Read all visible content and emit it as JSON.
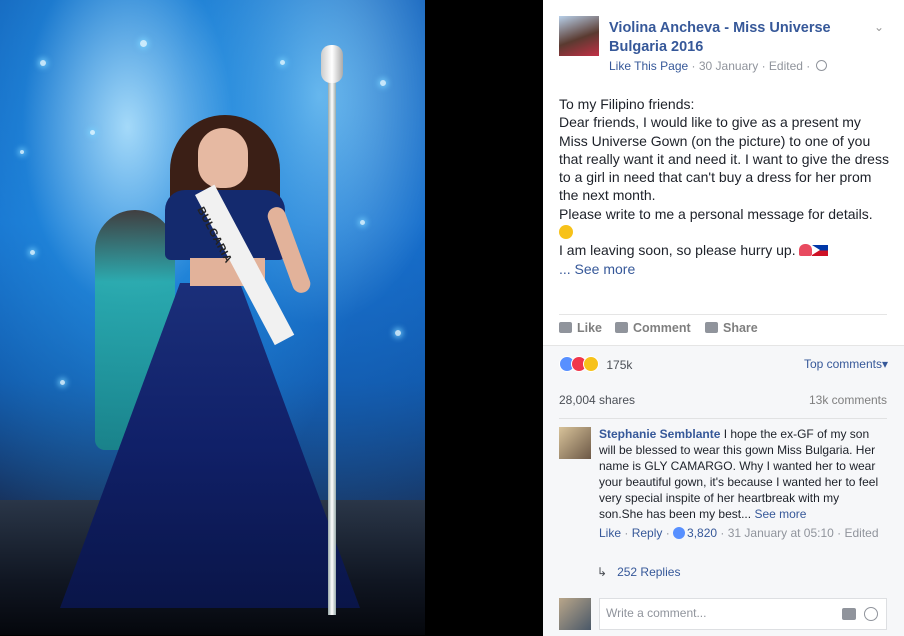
{
  "post": {
    "page_name": "Violina Ancheva - Miss Universe Bulgaria 2016",
    "like_page": "Like This Page",
    "date": "30 January",
    "edited": "Edited",
    "text_lines": [
      "To my Filipino friends:",
      "Dear friends, I would like to give as a present my Miss Universe Gown (on the picture) to one of you that really want it and need it. I want to give the dress to a girl in need that can't buy a dress for her prom the next month.",
      "Please write to me a personal message for details.",
      "I am leaving soon, so please hurry up."
    ],
    "see_more": "... See more"
  },
  "photo": {
    "sash_text": "BULGARIA"
  },
  "actions": {
    "like": "Like",
    "comment": "Comment",
    "share": "Share"
  },
  "stats": {
    "reactions_count": "175k",
    "top_comments": "Top comments",
    "shares": "28,004 shares",
    "comments": "13k comments"
  },
  "comment": {
    "author": "Stephanie Semblante",
    "text": "I hope the ex-GF of my son will be blessed to wear this gown Miss Bulgaria. Her name is GLY CAMARGO. Why I wanted her to wear your beautiful gown, it's because I wanted her to feel very special inspite of her heartbreak with my son.She has been my best...",
    "see_more": "See more",
    "like": "Like",
    "reply": "Reply",
    "like_count": "3,820",
    "time": "31 January at 05:10",
    "edited": "Edited",
    "replies": "252 Replies"
  },
  "composer": {
    "placeholder": "Write a comment..."
  },
  "icons": {
    "chevron": "chevron-down-icon",
    "globe": "globe-icon",
    "like": "thumbs-up-icon",
    "comment": "speech-bubble-icon",
    "share": "share-arrow-icon",
    "camera": "camera-icon",
    "emoji": "smiley-icon"
  },
  "colors": {
    "link": "#365899",
    "meta": "#90949c",
    "text": "#1d2129",
    "comments_bg": "#f6f7f9"
  }
}
